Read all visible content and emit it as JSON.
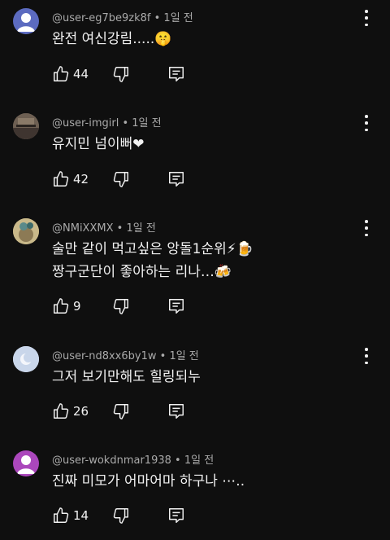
{
  "comments": [
    {
      "username": "@user-eg7be9zk8f",
      "time": "1일 전",
      "text_lines": [
        "완전 여신강림.....🤫"
      ],
      "likes": "44",
      "avatar_color": "#5c6bc0",
      "avatar_icon": "person-icon"
    },
    {
      "username": "@user-imgirl",
      "time": "1일 전",
      "text_lines": [
        "유지민 넘이뻐❤"
      ],
      "likes": "42",
      "avatar_color": "#6d5f52",
      "avatar_icon": "photo-avatar"
    },
    {
      "username": "@NMiXXMX",
      "time": "1일 전",
      "text_lines": [
        "술만 같이 먹고싶은 앙돌1순위⚡🍺",
        "짱구군단이 좋아하는 리나…🍻"
      ],
      "likes": "9",
      "avatar_color": "#b8a16e",
      "avatar_icon": "photo-avatar"
    },
    {
      "username": "@user-nd8xx6by1w",
      "time": "1일 전",
      "text_lines": [
        "그저 보기만해도 힐링되누"
      ],
      "likes": "26",
      "avatar_color": "#c9d6ea",
      "avatar_icon": "moon-icon"
    },
    {
      "username": "@user-wokdnmar1938",
      "time": "1일 전",
      "text_lines": [
        "진짜 미모가 어마어마 하구나 ⋯.."
      ],
      "likes": "14",
      "avatar_color": "#ab47bc",
      "avatar_icon": "person-icon"
    }
  ],
  "icons": {
    "like": "thumbs-up-icon",
    "dislike": "thumbs-down-icon",
    "reply": "reply-icon",
    "menu": "more-vert-icon"
  }
}
